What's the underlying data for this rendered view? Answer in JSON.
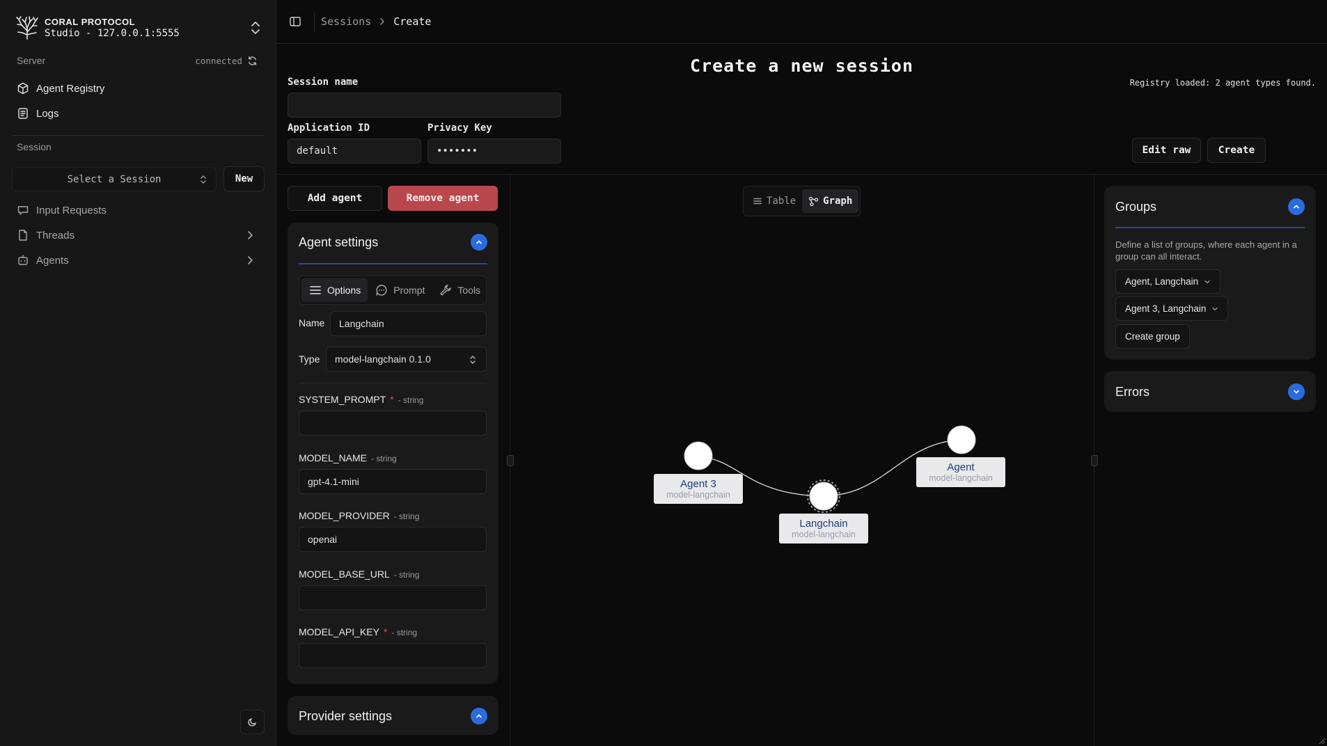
{
  "brand": {
    "title": "CORAL PROTOCOL",
    "subtitle": "Studio - 127.0.0.1:5555"
  },
  "sidebar": {
    "server_label": "Server",
    "server_status": "connected",
    "nav": [
      {
        "label": "Agent Registry",
        "icon": "registry-icon"
      },
      {
        "label": "Logs",
        "icon": "logs-icon"
      }
    ],
    "session_label": "Session",
    "session_select_placeholder": "Select a Session",
    "new_button": "New",
    "session_nav": [
      {
        "label": "Input Requests",
        "icon": "inbox-icon"
      },
      {
        "label": "Threads",
        "icon": "threads-icon"
      },
      {
        "label": "Agents",
        "icon": "agents-icon"
      }
    ]
  },
  "header": {
    "breadcrumb": [
      "Sessions",
      "Create"
    ]
  },
  "form": {
    "title": "Create a new session",
    "registry_message": "Registry loaded: 2 agent types found.",
    "session_name_label": "Session name",
    "session_name_value": "",
    "application_id_label": "Application ID",
    "application_id_value": "default",
    "privacy_key_label": "Privacy Key",
    "privacy_key_value": "•••••••",
    "edit_raw_button": "Edit raw",
    "create_button": "Create"
  },
  "agents_panel": {
    "add_button": "Add agent",
    "remove_button": "Remove agent",
    "settings_title": "Agent settings",
    "tabs": [
      "Options",
      "Prompt",
      "Tools"
    ],
    "active_tab": "Options",
    "name_label": "Name",
    "name_value": "Langchain",
    "type_label": "Type",
    "type_value": "model-langchain 0.1.0",
    "options": [
      {
        "key": "SYSTEM_PROMPT",
        "required": true,
        "type": "- string",
        "value": ""
      },
      {
        "key": "MODEL_NAME",
        "required": false,
        "type": "- string",
        "value": "gpt-4.1-mini"
      },
      {
        "key": "MODEL_PROVIDER",
        "required": false,
        "type": "- string",
        "value": "openai"
      },
      {
        "key": "MODEL_BASE_URL",
        "required": false,
        "type": "- string",
        "value": ""
      },
      {
        "key": "MODEL_API_KEY",
        "required": true,
        "type": "- string",
        "value": ""
      }
    ],
    "provider_title": "Provider settings"
  },
  "graph": {
    "view_tabs": [
      "Table",
      "Graph"
    ],
    "active_view": "Graph",
    "nodes": [
      {
        "name": "Agent 3",
        "type": "model-langchain"
      },
      {
        "name": "Langchain",
        "type": "model-langchain",
        "selected": true
      },
      {
        "name": "Agent",
        "type": "model-langchain"
      }
    ],
    "edges": [
      [
        "Agent 3",
        "Langchain"
      ],
      [
        "Langchain",
        "Agent"
      ]
    ]
  },
  "groups_panel": {
    "title": "Groups",
    "description": "Define a list of groups, where each agent in a group can all interact.",
    "groups": [
      "Agent, Langchain",
      "Agent 3, Langchain"
    ],
    "create_group_button": "Create group",
    "errors_title": "Errors"
  },
  "colors": {
    "accent": "#2a6ce0",
    "danger": "#b8484d",
    "node_label_bg": "#e9e9ec",
    "node_label_text": "#1f3e7c"
  }
}
